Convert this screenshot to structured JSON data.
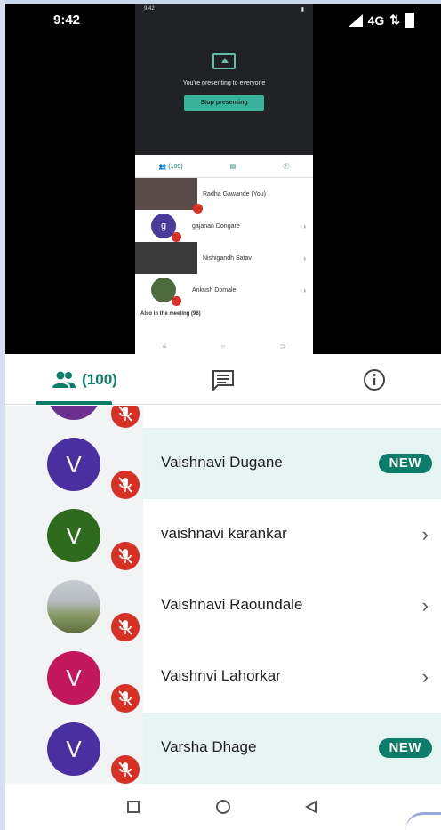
{
  "status_bar": {
    "time": "9:42",
    "network": "4G"
  },
  "thumbnail": {
    "status_time": "9:42",
    "presenting_text": "You're presenting to everyone",
    "stop_button": "Stop presenting",
    "people_count": "(100)",
    "rows": [
      {
        "name": "Radha Gawande (You)",
        "initial": "",
        "color": "#6b5a5a"
      },
      {
        "name": "gajanan Dongare",
        "initial": "g",
        "color": "#4a3a9c"
      },
      {
        "name": "Nishigandh Satav",
        "initial": "",
        "color": "#3b3b3b"
      },
      {
        "name": "Ankush Domale",
        "initial": "",
        "color": "#4d6b3c"
      }
    ],
    "also_in_meeting": "Also in the meeting (96)"
  },
  "tabs": {
    "people_label": "(100)",
    "people_icon": "people-icon",
    "chat_icon": "chat-icon",
    "info_icon": "info-icon",
    "accent": "#0b7d69"
  },
  "participants": [
    {
      "name": "Vaishnavi Dugane",
      "initial": "V",
      "avatar_color": "#4a2fa0",
      "badge": "NEW",
      "highlight": true
    },
    {
      "name": "vaishnavi karankar",
      "initial": "V",
      "avatar_color": "#2e6b1e",
      "badge": "",
      "highlight": false
    },
    {
      "name": "Vaishnavi Raoundale",
      "initial": "",
      "avatar_color": "photo",
      "badge": "",
      "highlight": false
    },
    {
      "name": "Vaishnvi Lahorkar",
      "initial": "V",
      "avatar_color": "#c2185b",
      "badge": "",
      "highlight": false
    },
    {
      "name": "Varsha Dhage",
      "initial": "V",
      "avatar_color": "#4a2fa0",
      "badge": "NEW",
      "highlight": true
    }
  ],
  "colors": {
    "mute_red": "#d93025",
    "highlight_bg": "#e6f4f2"
  }
}
